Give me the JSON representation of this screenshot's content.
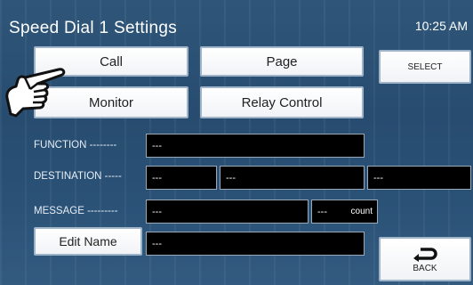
{
  "header": {
    "title": "Speed Dial 1 Settings",
    "time": "10:25 AM"
  },
  "buttons": {
    "call": "Call",
    "page": "Page",
    "select": "SELECT",
    "monitor": "Monitor",
    "relay_control": "Relay Control",
    "edit_name": "Edit Name",
    "back": "BACK"
  },
  "rows": {
    "function": {
      "label": "FUNCTION --------",
      "value": "---"
    },
    "destination": {
      "label": "DESTINATION -----",
      "value1": "---",
      "value2": "---",
      "value3": "---"
    },
    "message": {
      "label": "MESSAGE ---------",
      "value": "---",
      "count_value": "---",
      "count_label": "count"
    },
    "name": {
      "value": "---"
    }
  },
  "icons": {
    "pointer": "pointing-hand-icon",
    "back": "return-arrow-icon"
  },
  "colors": {
    "background": "#2a4f73",
    "field": "#000000",
    "button": "#ffffff"
  }
}
